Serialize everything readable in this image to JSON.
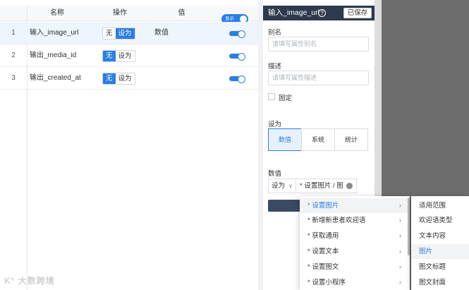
{
  "table": {
    "headers": {
      "name": "名称",
      "op": "操作",
      "value": "值",
      "toggle": "显示"
    },
    "rows": [
      {
        "index": "1",
        "name": "输入_image_url",
        "opt_none": "无",
        "opt_set": "设为",
        "active": "set",
        "value": "数值"
      },
      {
        "index": "2",
        "name": "输出_media_id",
        "opt_none": "无",
        "opt_set": "设为",
        "active": "none",
        "value": ""
      },
      {
        "index": "3",
        "name": "输出_created_at",
        "opt_none": "无",
        "opt_set": "设为",
        "active": "none",
        "value": ""
      }
    ]
  },
  "props": {
    "title": "输入_image_url",
    "help_icon": "?",
    "saved_label": "已保存",
    "alias_label": "别名",
    "alias_placeholder": "请填写属性别名",
    "desc_label": "描述",
    "desc_placeholder": "请填写属性描述",
    "fixed_label": "固定",
    "setas_label": "设为",
    "setas_options": [
      "数值",
      "系统",
      "统计"
    ],
    "value_label": "数值",
    "value_mode": "设为",
    "value_path": "* 设置图片 / 图"
  },
  "cascader": {
    "level1": [
      "* 设置图片",
      "* 新增新患者欢迎语",
      "* 获取通用",
      "* 设置文本",
      "* 设置图文",
      "* 设置小程序"
    ],
    "level2": [
      "适用范围",
      "欢迎语类型",
      "文本内容",
      "图片",
      "图文标题",
      "图文封面"
    ]
  },
  "watermark": "K° 大数跨境",
  "colors": {
    "accent": "#2a7ee3",
    "header_dark": "#2d3a4d"
  }
}
